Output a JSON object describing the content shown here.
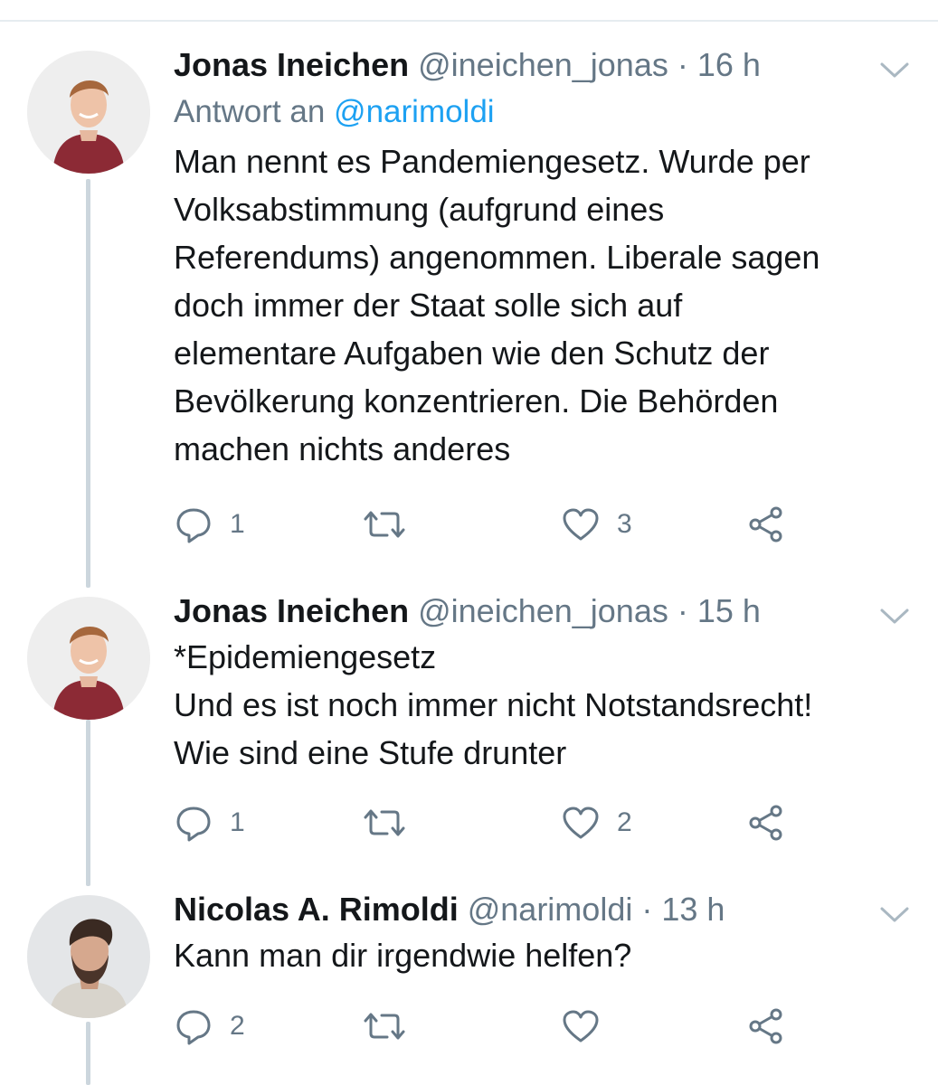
{
  "tweets": [
    {
      "name": "Jonas Ineichen",
      "handle": "@ineichen_jonas",
      "sep": "·",
      "time": "16 h",
      "reply_prefix": "Antwort an",
      "reply_to": "@narimoldi",
      "text": "Man nennt es Pandemiengesetz. Wurde per\nVolksabstimmung (aufgrund eines\nReferendums) angenommen. Liberale sagen\ndoch immer der Staat solle sich auf\nelementare Aufgaben wie den Schutz der\nBevölkerung konzentrieren. Die Behörden\nmachen nichts anderes",
      "replies": "1",
      "retweets": "",
      "likes": "3",
      "avatar_icon": "person-avatar-icon"
    },
    {
      "name": "Jonas Ineichen",
      "handle": "@ineichen_jonas",
      "sep": "·",
      "time": "15 h",
      "text": "*Epidemiengesetz\nUnd es ist noch immer nicht Notstandsrecht!\nWie sind eine Stufe drunter",
      "replies": "1",
      "retweets": "",
      "likes": "2",
      "avatar_icon": "person-avatar-icon"
    },
    {
      "name": "Nicolas A. Rimoldi",
      "handle": "@narimoldi",
      "sep": "·",
      "time": "13 h",
      "text": "Kann man dir irgendwie helfen?",
      "replies": "2",
      "retweets": "",
      "likes": "",
      "avatar_icon": "person-avatar-icon"
    }
  ],
  "colors": {
    "text": "#14171a",
    "secondary": "#657786",
    "link": "#1da1f2",
    "thread_line": "#ccd6dd",
    "divider": "#e6ecf0"
  },
  "icons": [
    "reply-icon",
    "retweet-icon",
    "like-icon",
    "share-icon",
    "chevron-down-icon"
  ]
}
